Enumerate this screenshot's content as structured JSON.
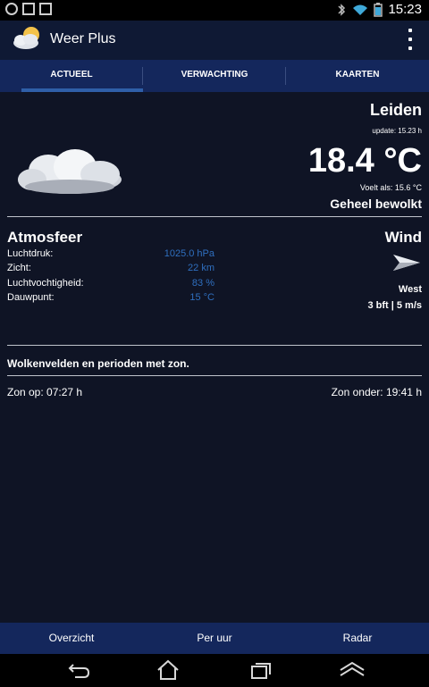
{
  "status_bar": {
    "time": "15:23"
  },
  "app": {
    "title": "Weer Plus"
  },
  "tabs": [
    {
      "label": "ACTUEEL",
      "active": true
    },
    {
      "label": "VERWACHTING",
      "active": false
    },
    {
      "label": "KAARTEN",
      "active": false
    }
  ],
  "current": {
    "location": "Leiden",
    "update": "update: 15.23 h",
    "temperature": "18.4 °C",
    "feels_like": "Voelt als: 15.6 °C",
    "condition": "Geheel bewolkt"
  },
  "atmosphere": {
    "title": "Atmosfeer",
    "rows": [
      {
        "label": "Luchtdruk:",
        "value": "1025.0 hPa"
      },
      {
        "label": "Zicht:",
        "value": "22 km"
      },
      {
        "label": "Luchtvochtigheid:",
        "value": "83 %"
      },
      {
        "label": "Dauwpunt:",
        "value": "15 °C"
      }
    ]
  },
  "wind": {
    "title": "Wind",
    "direction": "West",
    "speed": "3 bft | 5 m/s"
  },
  "summary": "Wolkenvelden en perioden met zon.",
  "sun": {
    "sunrise": "Zon op: 07:27 h",
    "sunset": "Zon onder: 19:41 h"
  },
  "bottom_tabs": [
    {
      "label": "Overzicht"
    },
    {
      "label": "Per uur"
    },
    {
      "label": "Radar"
    }
  ],
  "icons": {
    "weather": "cloud-icon",
    "wind": "wind-arrow-icon"
  },
  "colors": {
    "action_bar": "#0f1934",
    "tab_bar": "#14275c",
    "content_bg": "#0f1425",
    "value_blue": "#2f6fbf",
    "tab_indicator": "#2f5fa8"
  }
}
